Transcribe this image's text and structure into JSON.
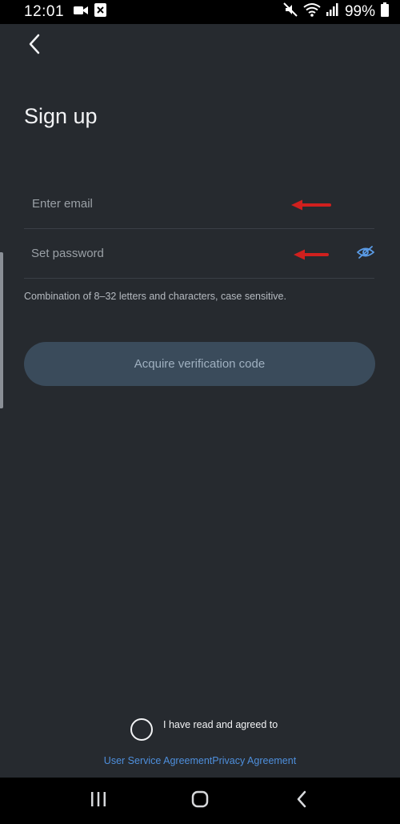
{
  "status_bar": {
    "time": "12:01",
    "battery_percent": "99%",
    "icons": [
      "video-camera-icon",
      "close-box-icon",
      "mute-icon",
      "wifi-icon",
      "signal-icon",
      "battery-icon"
    ]
  },
  "header": {
    "back_icon": "chevron-left-icon",
    "title": "Sign up"
  },
  "form": {
    "email": {
      "placeholder": "Enter email",
      "value": ""
    },
    "password": {
      "placeholder": "Set password",
      "value": "",
      "toggle_icon": "eye-slash-icon"
    },
    "hint": "Combination of 8–32 letters and characters, case sensitive.",
    "submit_label": "Acquire verification code"
  },
  "agreement": {
    "checked": false,
    "text": "I have read and agreed to",
    "user_service_link": "User Service Agreement",
    "privacy_link": "Privacy Agreement"
  },
  "colors": {
    "background": "#262a2f",
    "button_bg": "#3a4b5b",
    "button_text": "#9fb0c0",
    "link": "#4e8fdc",
    "annotation_arrow": "#d0201e"
  },
  "nav_bar": {
    "icons": [
      "recent-apps-icon",
      "home-icon",
      "back-icon"
    ]
  }
}
